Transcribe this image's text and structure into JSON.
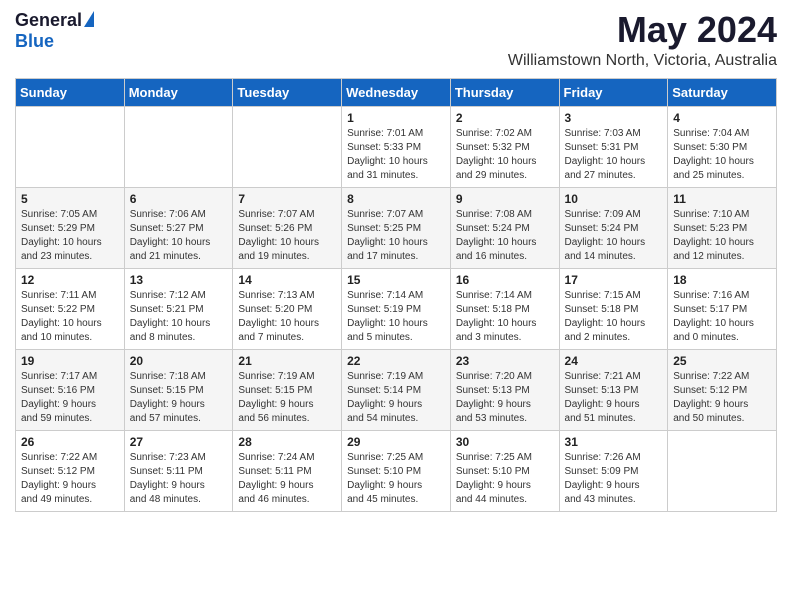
{
  "logo": {
    "general": "General",
    "blue": "Blue"
  },
  "title": "May 2024",
  "subtitle": "Williamstown North, Victoria, Australia",
  "headers": [
    "Sunday",
    "Monday",
    "Tuesday",
    "Wednesday",
    "Thursday",
    "Friday",
    "Saturday"
  ],
  "weeks": [
    [
      {
        "day": "",
        "info": ""
      },
      {
        "day": "",
        "info": ""
      },
      {
        "day": "",
        "info": ""
      },
      {
        "day": "1",
        "info": "Sunrise: 7:01 AM\nSunset: 5:33 PM\nDaylight: 10 hours\nand 31 minutes."
      },
      {
        "day": "2",
        "info": "Sunrise: 7:02 AM\nSunset: 5:32 PM\nDaylight: 10 hours\nand 29 minutes."
      },
      {
        "day": "3",
        "info": "Sunrise: 7:03 AM\nSunset: 5:31 PM\nDaylight: 10 hours\nand 27 minutes."
      },
      {
        "day": "4",
        "info": "Sunrise: 7:04 AM\nSunset: 5:30 PM\nDaylight: 10 hours\nand 25 minutes."
      }
    ],
    [
      {
        "day": "5",
        "info": "Sunrise: 7:05 AM\nSunset: 5:29 PM\nDaylight: 10 hours\nand 23 minutes."
      },
      {
        "day": "6",
        "info": "Sunrise: 7:06 AM\nSunset: 5:27 PM\nDaylight: 10 hours\nand 21 minutes."
      },
      {
        "day": "7",
        "info": "Sunrise: 7:07 AM\nSunset: 5:26 PM\nDaylight: 10 hours\nand 19 minutes."
      },
      {
        "day": "8",
        "info": "Sunrise: 7:07 AM\nSunset: 5:25 PM\nDaylight: 10 hours\nand 17 minutes."
      },
      {
        "day": "9",
        "info": "Sunrise: 7:08 AM\nSunset: 5:24 PM\nDaylight: 10 hours\nand 16 minutes."
      },
      {
        "day": "10",
        "info": "Sunrise: 7:09 AM\nSunset: 5:24 PM\nDaylight: 10 hours\nand 14 minutes."
      },
      {
        "day": "11",
        "info": "Sunrise: 7:10 AM\nSunset: 5:23 PM\nDaylight: 10 hours\nand 12 minutes."
      }
    ],
    [
      {
        "day": "12",
        "info": "Sunrise: 7:11 AM\nSunset: 5:22 PM\nDaylight: 10 hours\nand 10 minutes."
      },
      {
        "day": "13",
        "info": "Sunrise: 7:12 AM\nSunset: 5:21 PM\nDaylight: 10 hours\nand 8 minutes."
      },
      {
        "day": "14",
        "info": "Sunrise: 7:13 AM\nSunset: 5:20 PM\nDaylight: 10 hours\nand 7 minutes."
      },
      {
        "day": "15",
        "info": "Sunrise: 7:14 AM\nSunset: 5:19 PM\nDaylight: 10 hours\nand 5 minutes."
      },
      {
        "day": "16",
        "info": "Sunrise: 7:14 AM\nSunset: 5:18 PM\nDaylight: 10 hours\nand 3 minutes."
      },
      {
        "day": "17",
        "info": "Sunrise: 7:15 AM\nSunset: 5:18 PM\nDaylight: 10 hours\nand 2 minutes."
      },
      {
        "day": "18",
        "info": "Sunrise: 7:16 AM\nSunset: 5:17 PM\nDaylight: 10 hours\nand 0 minutes."
      }
    ],
    [
      {
        "day": "19",
        "info": "Sunrise: 7:17 AM\nSunset: 5:16 PM\nDaylight: 9 hours\nand 59 minutes."
      },
      {
        "day": "20",
        "info": "Sunrise: 7:18 AM\nSunset: 5:15 PM\nDaylight: 9 hours\nand 57 minutes."
      },
      {
        "day": "21",
        "info": "Sunrise: 7:19 AM\nSunset: 5:15 PM\nDaylight: 9 hours\nand 56 minutes."
      },
      {
        "day": "22",
        "info": "Sunrise: 7:19 AM\nSunset: 5:14 PM\nDaylight: 9 hours\nand 54 minutes."
      },
      {
        "day": "23",
        "info": "Sunrise: 7:20 AM\nSunset: 5:13 PM\nDaylight: 9 hours\nand 53 minutes."
      },
      {
        "day": "24",
        "info": "Sunrise: 7:21 AM\nSunset: 5:13 PM\nDaylight: 9 hours\nand 51 minutes."
      },
      {
        "day": "25",
        "info": "Sunrise: 7:22 AM\nSunset: 5:12 PM\nDaylight: 9 hours\nand 50 minutes."
      }
    ],
    [
      {
        "day": "26",
        "info": "Sunrise: 7:22 AM\nSunset: 5:12 PM\nDaylight: 9 hours\nand 49 minutes."
      },
      {
        "day": "27",
        "info": "Sunrise: 7:23 AM\nSunset: 5:11 PM\nDaylight: 9 hours\nand 48 minutes."
      },
      {
        "day": "28",
        "info": "Sunrise: 7:24 AM\nSunset: 5:11 PM\nDaylight: 9 hours\nand 46 minutes."
      },
      {
        "day": "29",
        "info": "Sunrise: 7:25 AM\nSunset: 5:10 PM\nDaylight: 9 hours\nand 45 minutes."
      },
      {
        "day": "30",
        "info": "Sunrise: 7:25 AM\nSunset: 5:10 PM\nDaylight: 9 hours\nand 44 minutes."
      },
      {
        "day": "31",
        "info": "Sunrise: 7:26 AM\nSunset: 5:09 PM\nDaylight: 9 hours\nand 43 minutes."
      },
      {
        "day": "",
        "info": ""
      }
    ]
  ]
}
